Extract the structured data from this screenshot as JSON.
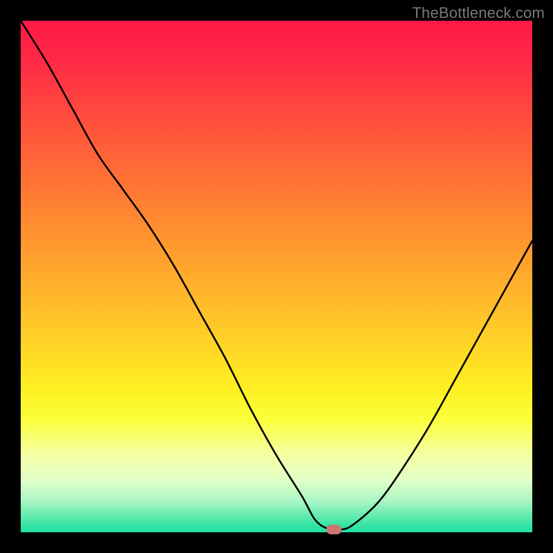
{
  "attribution": "TheBottleneck.com",
  "chart_data": {
    "type": "line",
    "title": "",
    "xlabel": "",
    "ylabel": "",
    "categories": [
      0.0,
      0.05,
      0.1,
      0.15,
      0.2,
      0.25,
      0.3,
      0.35,
      0.4,
      0.45,
      0.5,
      0.55,
      0.575,
      0.6,
      0.625,
      0.65,
      0.7,
      0.75,
      0.8,
      0.85,
      0.9,
      0.95,
      1.0
    ],
    "values": [
      100,
      92,
      83,
      74,
      67,
      60,
      52,
      43,
      34,
      24,
      15,
      7,
      2.5,
      0.7,
      0.5,
      1.5,
      6,
      13,
      21,
      30,
      39,
      48,
      57
    ],
    "ylim": [
      0,
      100
    ],
    "xlim": [
      0,
      1
    ],
    "marker": {
      "x": 0.612,
      "y": 0.5
    },
    "background_gradient": [
      {
        "stop": 0.0,
        "color": "#ff1846"
      },
      {
        "stop": 0.5,
        "color": "#ffb72a"
      },
      {
        "stop": 0.78,
        "color": "#fbff3a"
      },
      {
        "stop": 1.0,
        "color": "#1fe0a0"
      }
    ],
    "line_color": "#000000",
    "marker_color": "#cd7671"
  }
}
